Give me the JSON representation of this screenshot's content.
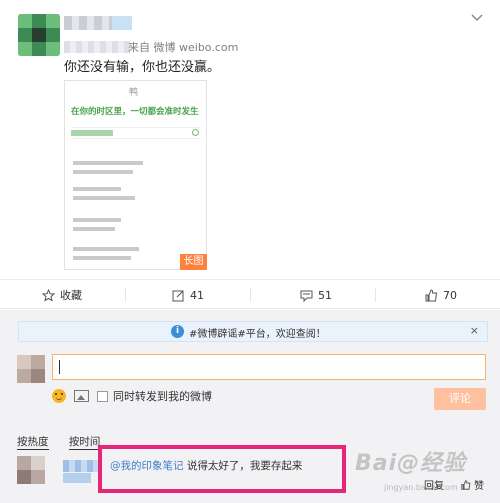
{
  "post": {
    "source": "来自 微博 weibo.com",
    "text": "你还没有输，你也还没赢。",
    "image": {
      "logo": "鸭",
      "slogan": "在你的时区里，一切都会准时发生",
      "badge": "长图"
    }
  },
  "actions": {
    "favorite": "收藏",
    "forward": "41",
    "comment": "51",
    "like": "70"
  },
  "comment_box": {
    "notice": "#微博辟谣#平台，欢迎查阅！",
    "close": "×",
    "repost_label": "同时转发到我的微博",
    "submit": "评论"
  },
  "comments": {
    "sort_hot": "按热度",
    "sort_time": "按时间",
    "items": [
      {
        "mention": "@我的印象笔记",
        "text": " 说得太好了，我要存起来",
        "reply": "回复",
        "like": "赞"
      }
    ]
  },
  "watermark": {
    "brand": "Bai@经验",
    "sub": "jingyan.baidu.com"
  },
  "colors": {
    "accent_orange": "#ff8140",
    "highlight_pink": "#e6267a",
    "link_blue": "#3b7fc4",
    "slogan_green": "#4aa34e"
  }
}
